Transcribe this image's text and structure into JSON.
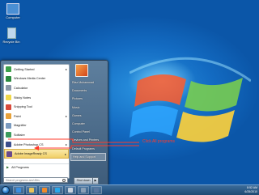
{
  "desktop": {
    "icons": [
      {
        "label": "Computer",
        "icon": "computer-icon",
        "color": "#4a8fd4"
      },
      {
        "label": "Recycle Bin",
        "icon": "recycle-bin-icon",
        "color": "#bfd8ee"
      }
    ]
  },
  "start_menu": {
    "pinned_programs": [
      {
        "label": "Getting Started",
        "icon": "getting-started-icon",
        "color": "#3da14a",
        "has_submenu": true
      },
      {
        "label": "Windows Media Center",
        "icon": "media-center-icon",
        "color": "#2b8a3e",
        "has_submenu": false
      },
      {
        "label": "Calculator",
        "icon": "calculator-icon",
        "color": "#8a96a6",
        "has_submenu": false
      },
      {
        "label": "Sticky Notes",
        "icon": "sticky-notes-icon",
        "color": "#f0d84a",
        "has_submenu": false
      },
      {
        "label": "Snipping Tool",
        "icon": "scissors-icon",
        "color": "#d94a3a",
        "has_submenu": false
      },
      {
        "label": "Paint",
        "icon": "paint-icon",
        "color": "#e7a23a",
        "has_submenu": true
      },
      {
        "label": "Magnifier",
        "icon": "magnifier-icon",
        "color": "#7a9abf",
        "has_submenu": false
      },
      {
        "label": "Solitaire",
        "icon": "solitaire-icon",
        "color": "#3c9c5c",
        "has_submenu": false
      },
      {
        "label": "Adobe Photoshop CS",
        "icon": "photoshop-icon",
        "color": "#3a4e8c",
        "has_submenu": true
      },
      {
        "label": "Adobe ImageReady CS",
        "icon": "imageready-icon",
        "color": "#6a4a8c",
        "has_submenu": true
      }
    ],
    "all_programs_label": "All Programs",
    "search_placeholder": "Search programs and files",
    "right_items": [
      "Riaz Muhammad",
      "Documents",
      "Pictures",
      "Music",
      "Games",
      "Computer",
      "Control Panel",
      "Devices and Printers",
      "Default Programs",
      "Help and Support"
    ],
    "shutdown_label": "Shut down",
    "shutdown_arrow": "▶"
  },
  "annotation": {
    "text": "Click All programs",
    "color": "#ff3a2a"
  },
  "taskbar": {
    "pinned": [
      {
        "icon": "internet-explorer-icon",
        "color": "#3b8fe0"
      },
      {
        "icon": "windows-explorer-icon",
        "color": "#e8c35a"
      },
      {
        "icon": "media-player-icon",
        "color": "#f08a2a"
      },
      {
        "icon": "skype-icon",
        "color": "#28a8ea"
      },
      {
        "icon": "app-icon",
        "color": "#c9d3de"
      },
      {
        "icon": "app-icon-2",
        "color": "#8aa0b6"
      },
      {
        "icon": "app-icon-3",
        "color": "#5a78a0"
      }
    ],
    "time": "8:52 AM",
    "date": "6/25/2010"
  }
}
